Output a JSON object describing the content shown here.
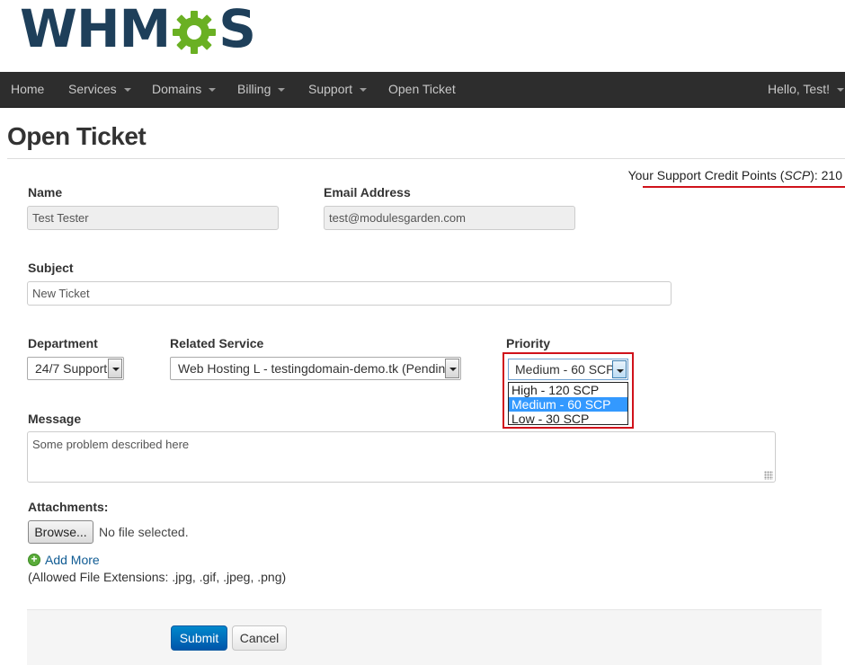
{
  "brand": {
    "logo_text_1": "WHM",
    "logo_text_2": "S",
    "gear_icon": "gear-icon",
    "colors": {
      "navy": "#1e3f5a",
      "green": "#6ab023"
    }
  },
  "nav": {
    "home": "Home",
    "services": "Services",
    "domains": "Domains",
    "billing": "Billing",
    "support": "Support",
    "open_ticket": "Open Ticket",
    "user": "Hello, Test!"
  },
  "page": {
    "title": "Open Ticket"
  },
  "scp": {
    "prefix": "Your Support Credit Points (",
    "abbr": "SCP",
    "suffix": "): 210"
  },
  "form": {
    "name_label": "Name",
    "name_value": "Test Tester",
    "email_label": "Email Address",
    "email_value": "test@modulesgarden.com",
    "subject_label": "Subject",
    "subject_value": "New Ticket",
    "department_label": "Department",
    "department_value": "24/7 Support",
    "service_label": "Related Service",
    "service_value": "Web Hosting L - testingdomain-demo.tk (Pending)",
    "priority_label": "Priority",
    "priority_value": "Medium - 60 SCP",
    "priority_options": [
      "High - 120 SCP",
      "Medium - 60 SCP",
      "Low - 30 SCP"
    ],
    "message_label": "Message",
    "message_value": "Some problem described here",
    "attachments_label": "Attachments:",
    "browse_label": "Browse...",
    "no_file": "No file selected.",
    "add_more": "Add More",
    "allowed_ext": "(Allowed File Extensions: .jpg, .gif, .jpeg, .png)",
    "submit_label": "Submit",
    "cancel_label": "Cancel"
  },
  "colors": {
    "highlight": "#d0121b",
    "primary": "#0077c0",
    "selected_option": "#3399ff"
  }
}
